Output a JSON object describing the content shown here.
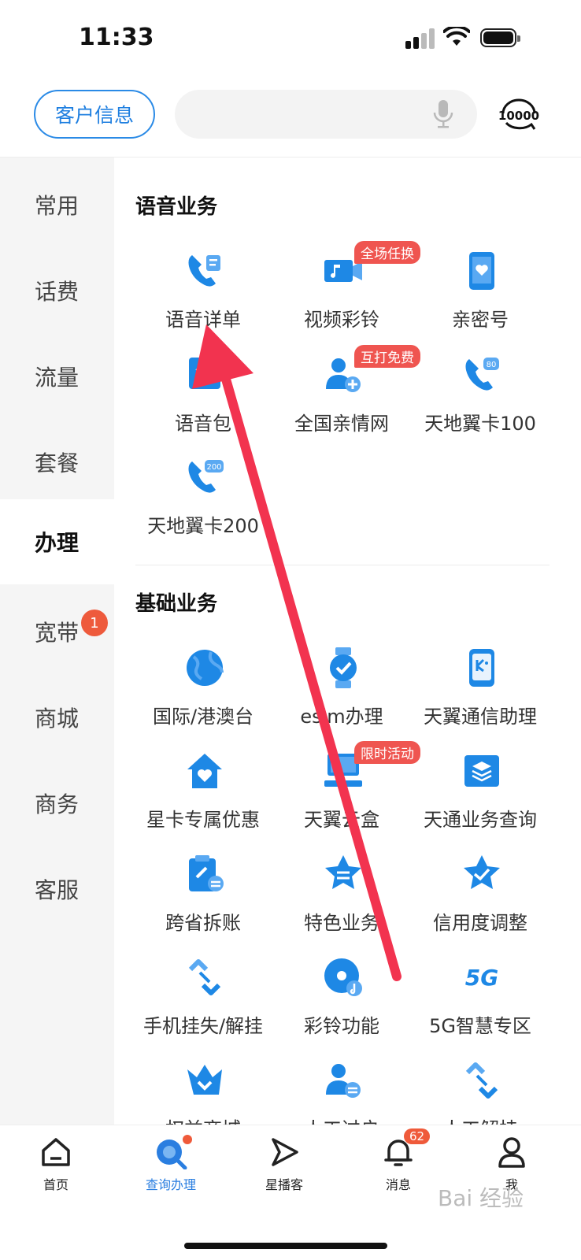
{
  "status_bar": {
    "time": "11:33"
  },
  "header": {
    "customer_info": "客户信息",
    "search_placeholder": "",
    "logo_text": "10000"
  },
  "sidebar": {
    "items": [
      {
        "label": "常用"
      },
      {
        "label": "话费"
      },
      {
        "label": "流量"
      },
      {
        "label": "套餐"
      },
      {
        "label": "办理",
        "active": true
      },
      {
        "label": "宽带",
        "badge": "1"
      },
      {
        "label": "商城"
      },
      {
        "label": "商务"
      },
      {
        "label": "客服"
      }
    ]
  },
  "sections": [
    {
      "title": "语音业务",
      "items": [
        {
          "label": "语音详单",
          "icon": "phone-detail-icon"
        },
        {
          "label": "视频彩铃",
          "icon": "video-ringtone-icon",
          "tag": "全场任换"
        },
        {
          "label": "亲密号",
          "icon": "heart-phone-icon"
        },
        {
          "label": "语音包",
          "icon": "voice-pack-icon"
        },
        {
          "label": "全国亲情网",
          "icon": "family-network-icon",
          "tag": "互打免费"
        },
        {
          "label": "天地翼卡100",
          "icon": "phone-80-icon",
          "icon_text": "80"
        },
        {
          "label": "天地翼卡200",
          "icon": "phone-200-icon",
          "icon_text": "200"
        }
      ]
    },
    {
      "title": "基础业务",
      "items": [
        {
          "label": "国际/港澳台",
          "icon": "globe-icon"
        },
        {
          "label": "esim办理",
          "icon": "watch-icon"
        },
        {
          "label": "天翼通信助理",
          "icon": "assistant-icon"
        },
        {
          "label": "星卡专属优惠",
          "icon": "house-heart-icon"
        },
        {
          "label": "天翼云盒",
          "icon": "cloud-box-icon",
          "tag": "限时活动"
        },
        {
          "label": "天通业务查询",
          "icon": "layers-icon"
        },
        {
          "label": "跨省拆账",
          "icon": "clipboard-link-icon"
        },
        {
          "label": "特色业务",
          "icon": "star-badge-icon"
        },
        {
          "label": "信用度调整",
          "icon": "star-check-icon"
        },
        {
          "label": "手机挂失/解挂",
          "icon": "link-icon"
        },
        {
          "label": "彩铃功能",
          "icon": "disc-icon"
        },
        {
          "label": "5G智慧专区",
          "icon": "5g-icon",
          "icon_text": "5G"
        },
        {
          "label": "权益商城",
          "icon": "crown-icon"
        },
        {
          "label": "人工过户",
          "icon": "person-transfer-icon"
        },
        {
          "label": "人工解挂",
          "icon": "link-icon"
        }
      ]
    }
  ],
  "tabbar": {
    "items": [
      {
        "label": "首页",
        "icon": "home-icon"
      },
      {
        "label": "查询办理",
        "icon": "search-query-icon",
        "active": true
      },
      {
        "label": "星播客",
        "icon": "play-icon"
      },
      {
        "label": "消息",
        "icon": "bell-icon",
        "badge": "62"
      },
      {
        "label": "我",
        "icon": "person-icon"
      }
    ]
  },
  "watermark": "Bai 经验",
  "colors": {
    "accent": "#2a8ae6",
    "icon_blue": "#1e88e5",
    "badge_red": "#ef5a3a",
    "arrow_red": "#f2334f"
  }
}
